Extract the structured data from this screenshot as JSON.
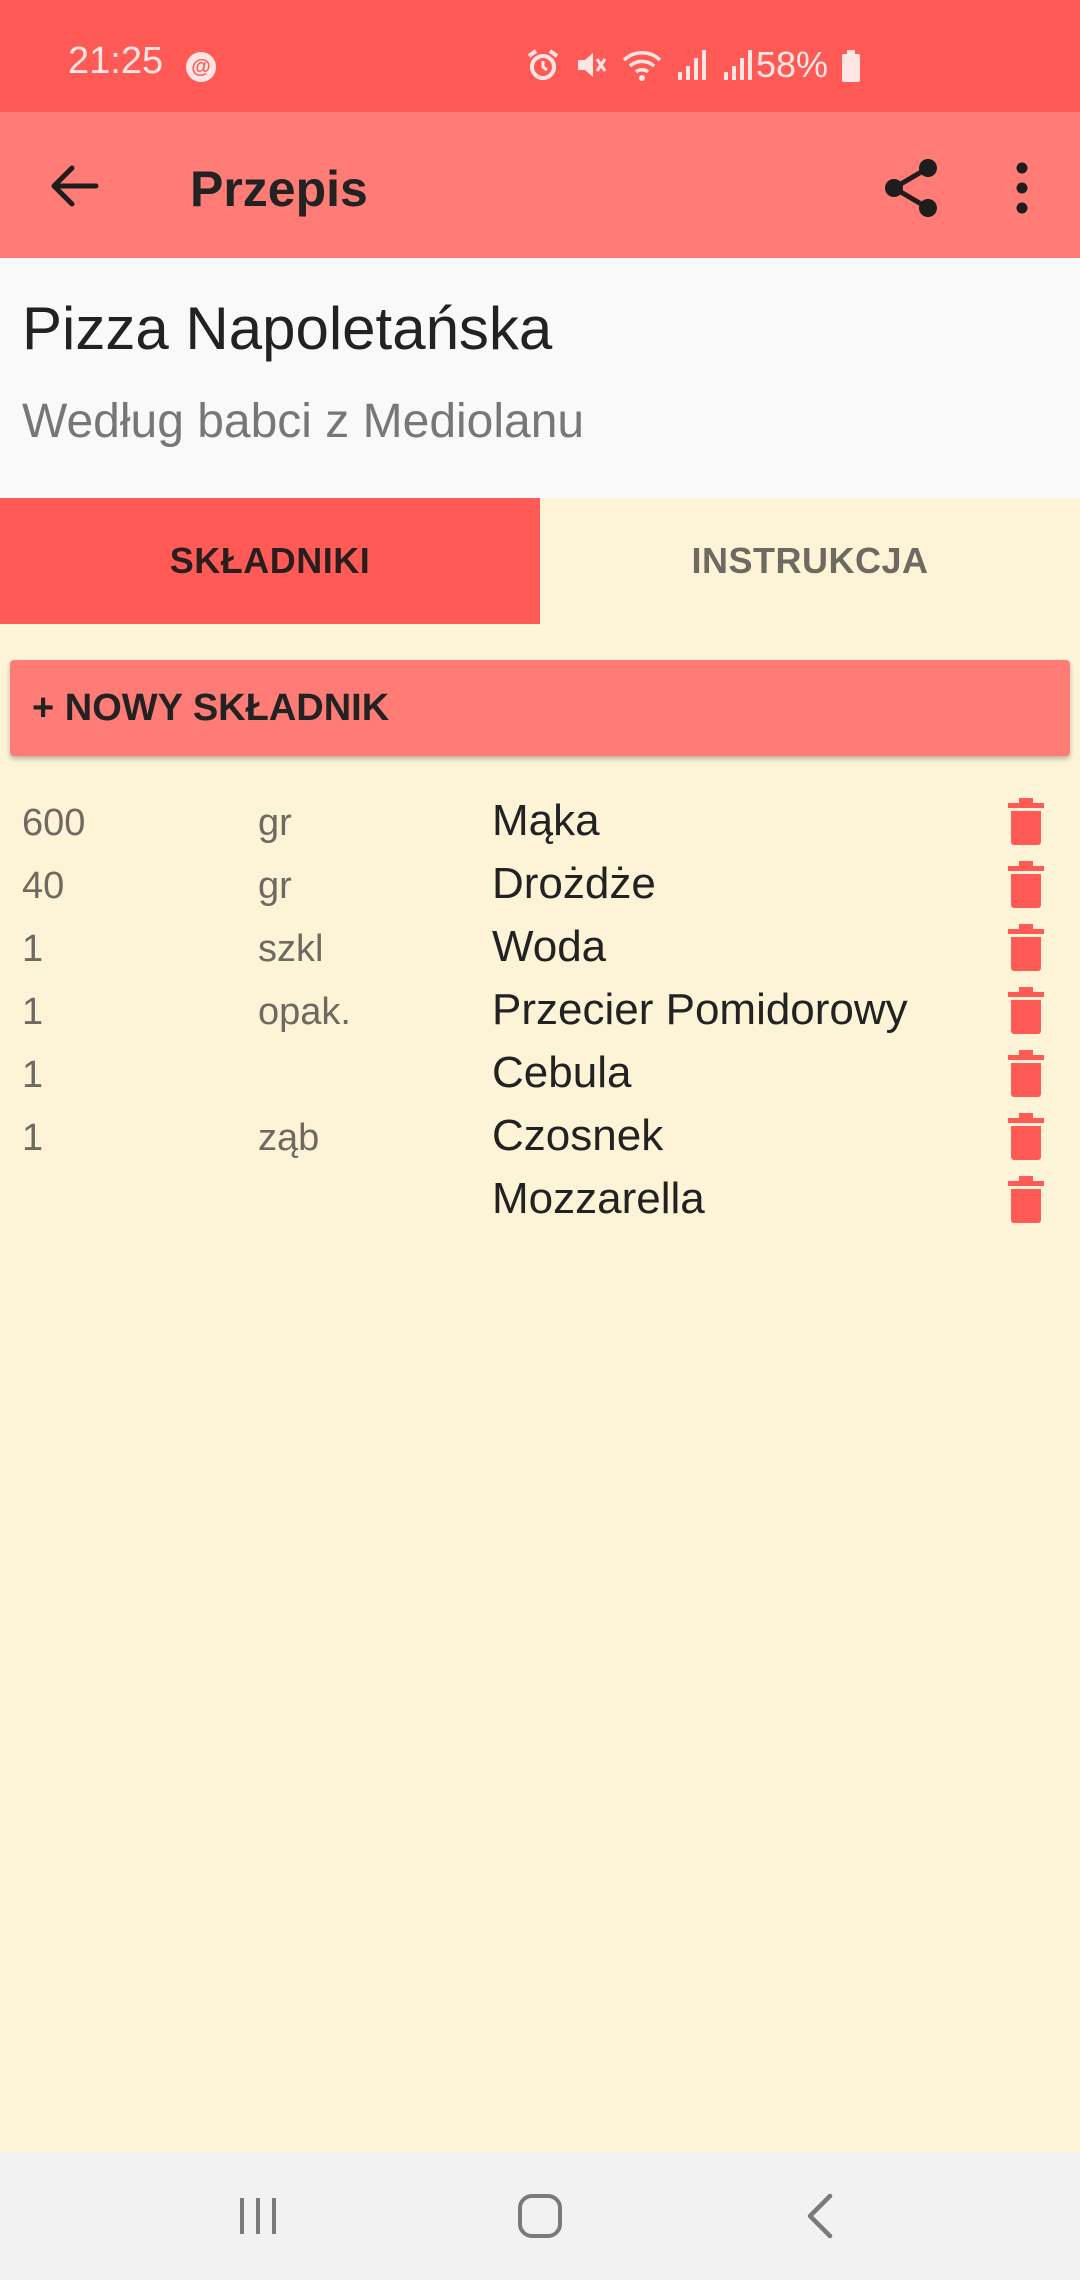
{
  "status_bar": {
    "time": "21:25",
    "battery": "58%"
  },
  "app_bar": {
    "title": "Przepis"
  },
  "recipe": {
    "title": "Pizza Napoletańska",
    "subtitle": "Według babci z Mediolanu"
  },
  "tabs": [
    {
      "label": "SKŁADNIKI",
      "active": true
    },
    {
      "label": "INSTRUKCJA",
      "active": false
    }
  ],
  "add_button": {
    "label": "+ NOWY SKŁADNIK"
  },
  "ingredients": [
    {
      "qty": "600",
      "unit": "gr",
      "name": "Mąka"
    },
    {
      "qty": "40",
      "unit": "gr",
      "name": "Drożdże"
    },
    {
      "qty": "1",
      "unit": "szkl",
      "name": "Woda"
    },
    {
      "qty": "1",
      "unit": "opak.",
      "name": "Przecier Pomidorowy"
    },
    {
      "qty": "1",
      "unit": "",
      "name": "Cebula"
    },
    {
      "qty": "1",
      "unit": "ząb",
      "name": "Czosnek"
    },
    {
      "qty": "",
      "unit": "",
      "name": "Mozzarella"
    }
  ],
  "colors": {
    "accent": "#ff5a55",
    "app_bar": "#ff7b76",
    "background": "#fdf3d7"
  },
  "icons": {
    "back": "arrow-back-icon",
    "share": "share-icon",
    "more": "more-vert-icon",
    "delete": "trash-icon"
  }
}
